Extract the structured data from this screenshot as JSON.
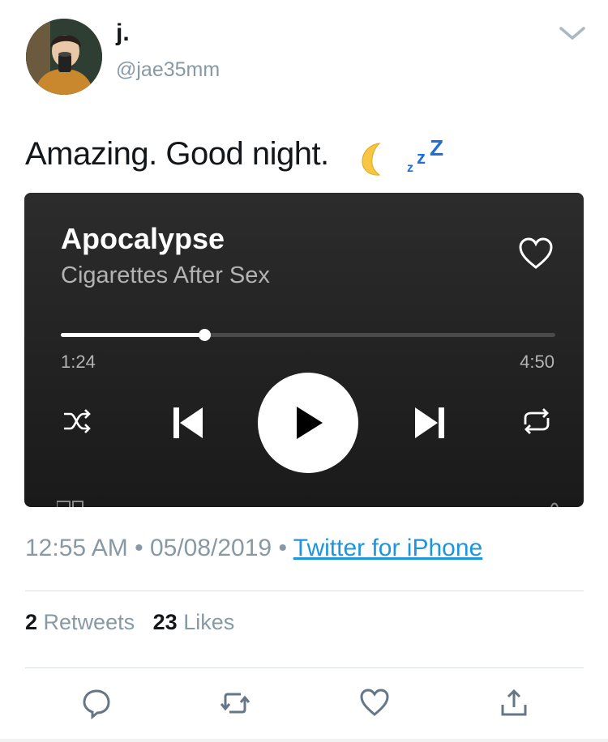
{
  "header": {
    "display_name": "j.",
    "handle": "@jae35mm"
  },
  "tweet": {
    "text": "Amazing. Good night.",
    "emoji": [
      "crescent-moon",
      "zzz"
    ]
  },
  "player": {
    "song_title": "Apocalypse",
    "artist": "Cigarettes After Sex",
    "elapsed": "1:24",
    "total": "4:50",
    "progress": 0.29,
    "icons": [
      "heart-icon",
      "shuffle-icon",
      "previous-icon",
      "play-icon",
      "next-icon",
      "repeat-icon"
    ]
  },
  "meta": {
    "time": "12:55 AM",
    "separator": "•",
    "date": "05/08/2019",
    "source": "Twitter for iPhone"
  },
  "stats": {
    "retweets_count": "2",
    "retweets_label": "Retweets",
    "likes_count": "23",
    "likes_label": "Likes"
  },
  "actions": [
    "reply-icon",
    "retweet-icon",
    "like-icon",
    "share-icon"
  ],
  "colors": {
    "link": "#1b95e0",
    "secondary_text": "#8899a6",
    "player_bg": "#282828"
  }
}
